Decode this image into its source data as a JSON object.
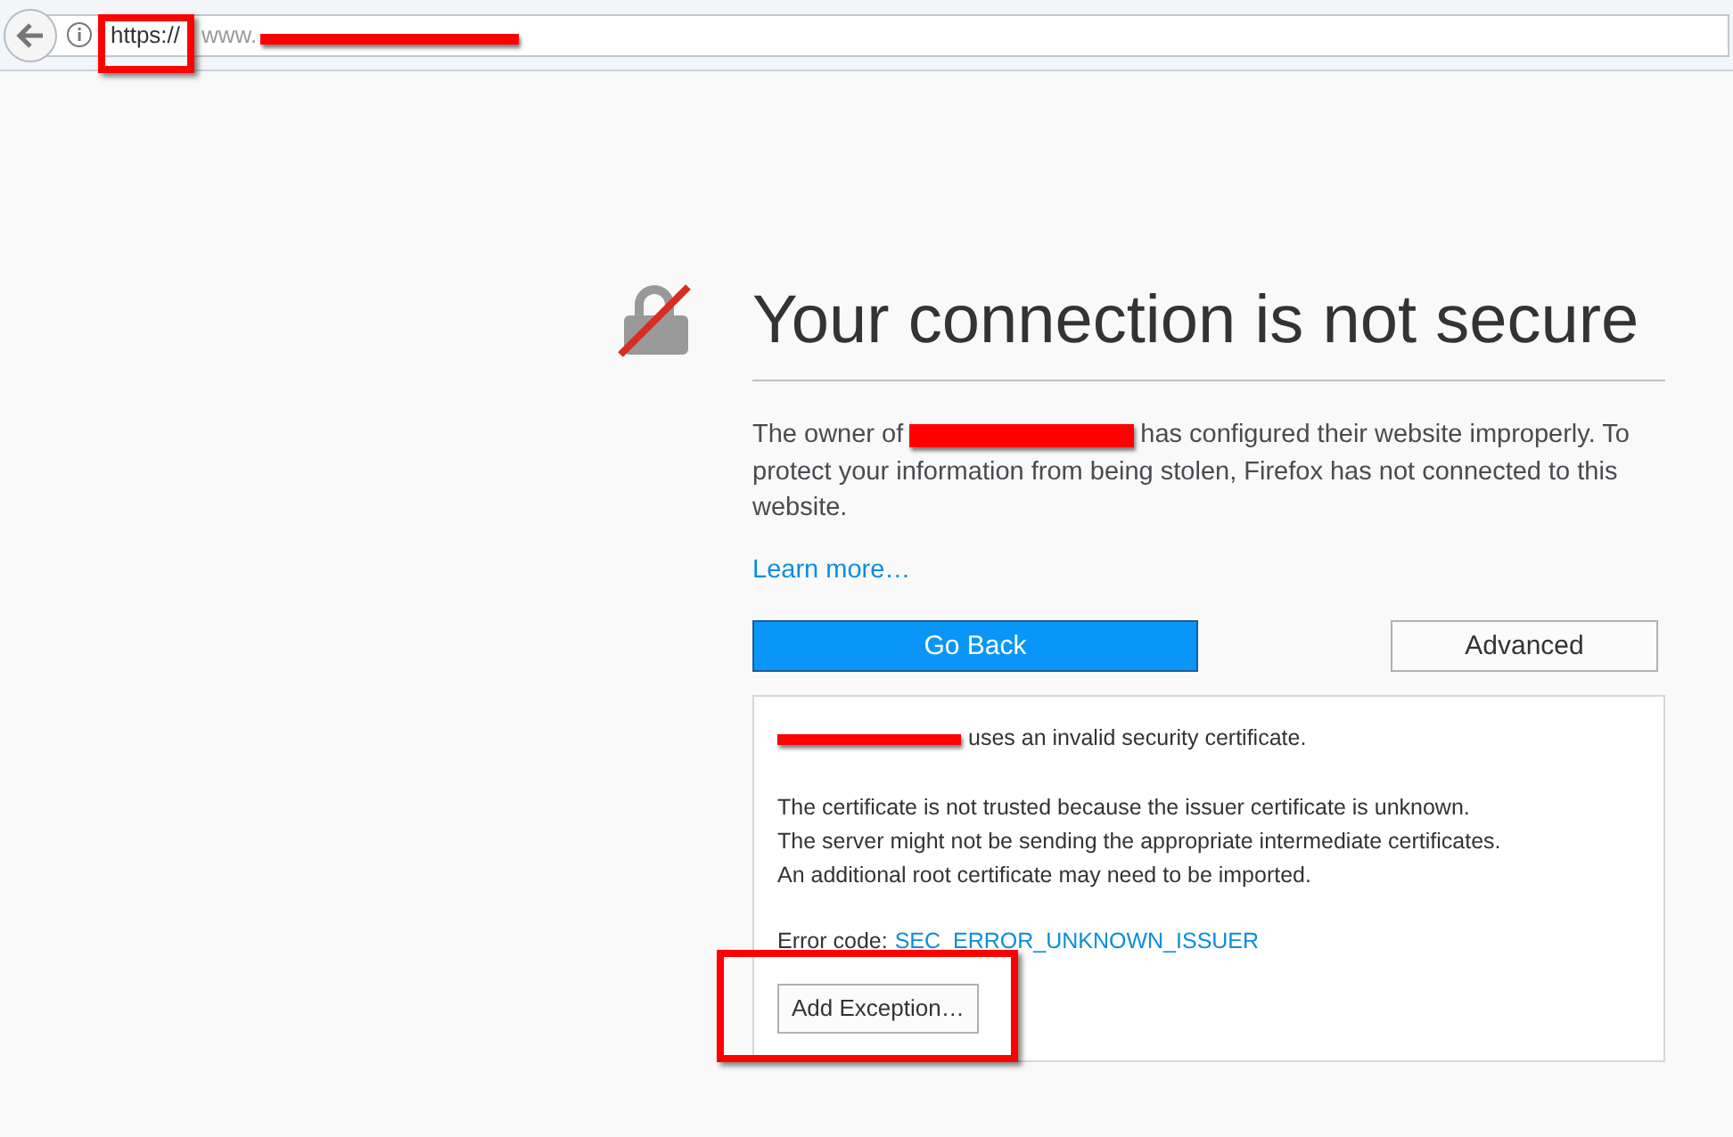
{
  "address_bar": {
    "scheme": "https://",
    "host": "www."
  },
  "page": {
    "title": "Your connection is not secure",
    "description": {
      "before": "The owner of",
      "after": "has configured their website improperly. To",
      "rest": "protect your information from being stolen, Firefox has not connected to this website."
    },
    "learn_more": "Learn more…",
    "buttons": [
      {
        "label": "Go Back",
        "kind": "primary"
      },
      {
        "label": "Advanced",
        "kind": "secondary"
      }
    ],
    "advanced_panel": {
      "intro": "uses an invalid security certificate.",
      "details": [
        "The certificate is not trusted because the issuer certificate is unknown.",
        "The server might not be sending the appropriate intermediate certificates.",
        "An additional root certificate may need to be imported."
      ],
      "error_label": "Error code:",
      "error_code": "SEC_ERROR_UNKNOWN_ISSUER",
      "exception_button": "Add Exception…"
    }
  }
}
